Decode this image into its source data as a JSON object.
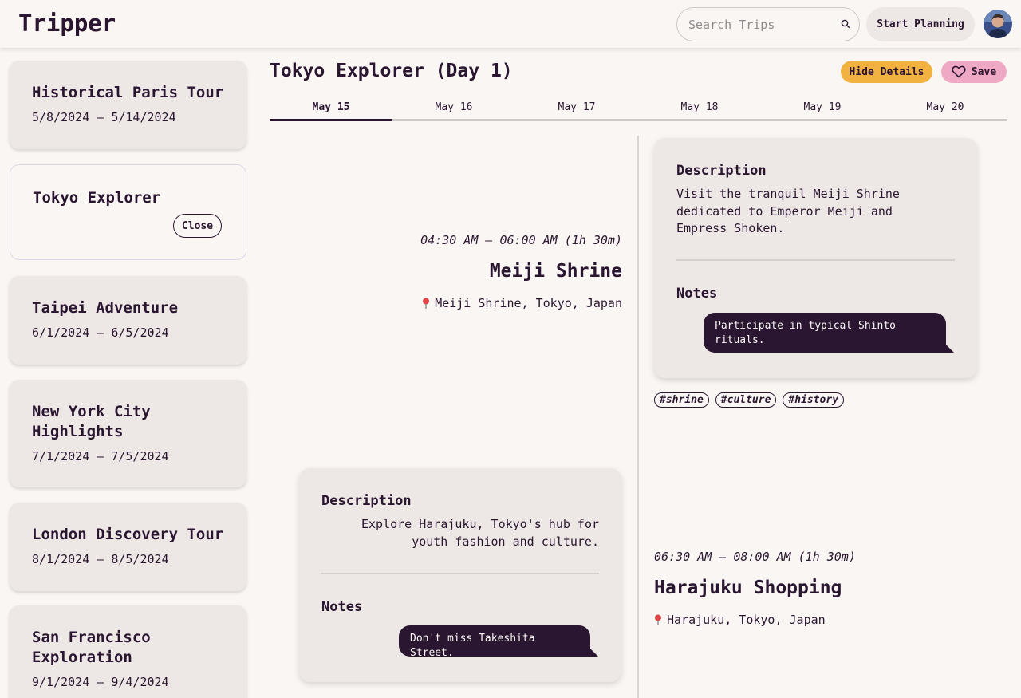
{
  "header": {
    "logo": "Tripper",
    "search_placeholder": "Search Trips",
    "start_planning_label": "Start Planning"
  },
  "sidebar": {
    "trips": [
      {
        "title": "Historical Paris Tour",
        "dates": "5/8/2024 – 5/14/2024"
      },
      {
        "title": "Tokyo Explorer",
        "dates": "",
        "close_label": "Close"
      },
      {
        "title": "Taipei Adventure",
        "dates": "6/1/2024 – 6/5/2024"
      },
      {
        "title": "New York City Highlights",
        "dates": "7/1/2024 – 7/5/2024"
      },
      {
        "title": "London Discovery Tour",
        "dates": "8/1/2024 – 8/5/2024"
      },
      {
        "title": "San Francisco Exploration",
        "dates": "9/1/2024 – 9/4/2024"
      }
    ]
  },
  "main": {
    "title": "Tokyo Explorer (Day 1)",
    "hide_details_label": "Hide Details",
    "save_label": "Save",
    "tabs": [
      "May 15",
      "May 16",
      "May 17",
      "May 18",
      "May 19",
      "May 20"
    ],
    "active_tab": 0
  },
  "events": [
    {
      "time": "04:30 AM – 06:00 AM (1h 30m)",
      "title": "Meiji Shrine",
      "location": "Meiji Shrine, Tokyo, Japan",
      "description_heading": "Description",
      "description": "Visit the tranquil Meiji Shrine dedicated to Emperor Meiji and Empress Shoken.",
      "notes_heading": "Notes",
      "note": "Participate in typical Shinto rituals.",
      "tags": [
        "#shrine",
        "#culture",
        "#history"
      ]
    },
    {
      "time": "06:30 AM – 08:00 AM (1h 30m)",
      "title": "Harajuku Shopping",
      "location": "Harajuku, Tokyo, Japan",
      "description_heading": "Description",
      "description": "Explore Harajuku, Tokyo's hub for youth fashion and culture.",
      "notes_heading": "Notes",
      "note": "Don't miss Takeshita Street."
    }
  ],
  "icons": {
    "search": "search-icon",
    "heart": "heart-icon",
    "pin": "map-pin-icon",
    "avatar": "user-avatar"
  },
  "colors": {
    "primary_dark": "#2a1630",
    "hide_button": "#f2b240",
    "save_button": "#f0a9c4",
    "card_bg": "#ede8e5",
    "page_bg": "#faf6f3"
  }
}
